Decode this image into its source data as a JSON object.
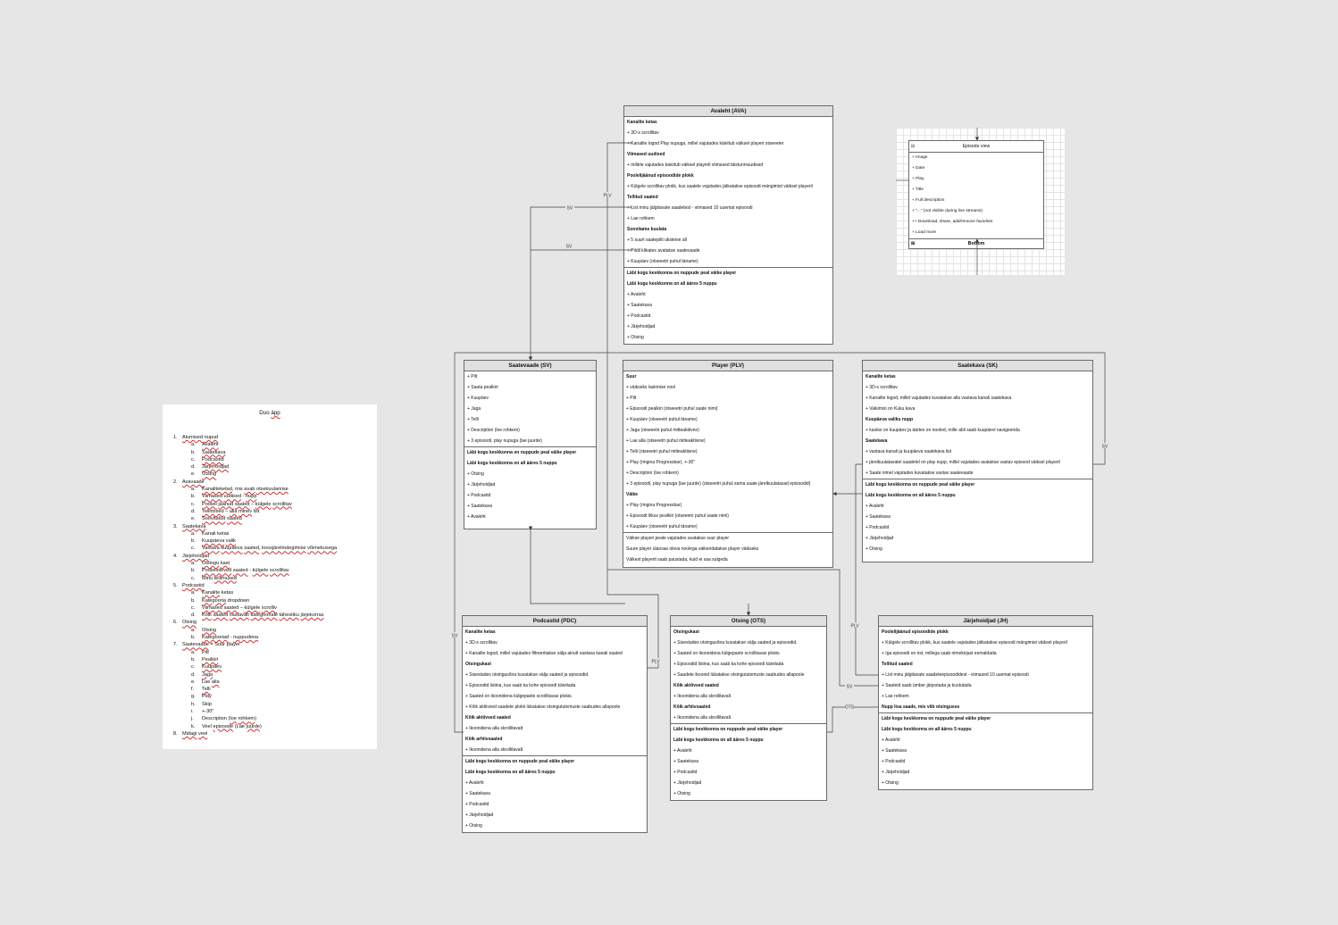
{
  "doc": {
    "title_plain": "Duo ",
    "title_underlined": "äpp",
    "items": [
      {
        "level": 1,
        "n": "1.",
        "html": "<u>Alumised</u> <u>nupud</u>"
      },
      {
        "level": 2,
        "n": "a.",
        "html": "<u>Avaleht</u>"
      },
      {
        "level": 2,
        "n": "b.",
        "html": "<u>Saatekava</u>"
      },
      {
        "level": 2,
        "n": "c.",
        "html": "<u>Podcastid</u>"
      },
      {
        "level": 2,
        "n": "d.",
        "html": "<u>Järjehoidjad</u>"
      },
      {
        "level": 2,
        "n": "e.",
        "html": "<u>Otsing</u>"
      },
      {
        "level": 1,
        "n": "2.",
        "html": "<u>Avavaade</u>"
      },
      {
        "level": 2,
        "n": "a.",
        "html": "<u>Kanaliteketad</u>, mis <u>avab</u> <u>otsekuulamise</u>"
      },
      {
        "level": 2,
        "n": "b.",
        "html": "<u>Viimased</u> <u>uudised</u> - <u>nupp</u>"
      },
      {
        "level": 2,
        "n": "c.",
        "html": "<u>Pooleli</u> <u>jäänud</u> <u>saated</u> – <u>külgele</u> <u>scrollitav</u>"
      },
      {
        "level": 2,
        "n": "d.",
        "html": "<u>Tellimised</u> – <u>alla</u> <u>minev</u> list"
      },
      {
        "level": 2,
        "n": "e.",
        "html": "<u>Soovitatud</u> <u>saated</u>"
      },
      {
        "level": 1,
        "n": "3.",
        "html": "<u>Saatekava</u>"
      },
      {
        "level": 2,
        "n": "a.",
        "html": "Kanali ketas"
      },
      {
        "level": 2,
        "n": "b.",
        "html": "<u>Kuupäeva</u> <u>valik</u>"
      },
      {
        "level": 2,
        "n": "c.",
        "html": "<u>Vastava</u> <u>kuupäeva</u> <u>saated</u>, <u>koosjärelmängimise</u> <u>võimekusega</u>"
      },
      {
        "level": 1,
        "n": "4.",
        "html": "<u>Järjehoidjad</u>"
      },
      {
        "level": 2,
        "n": "a.",
        "html": "<u>Otsingu</u> <u>kast</u>"
      },
      {
        "level": 2,
        "n": "b.",
        "html": "<u>Poolelioleved</u> <u>saated</u>  - <u>külgele</u> <u>scrollitav</u>"
      },
      {
        "level": 2,
        "n": "c.",
        "html": "Minu <u>tellimused</u>"
      },
      {
        "level": 1,
        "n": "5.",
        "html": "<u>Podcastid</u>"
      },
      {
        "level": 2,
        "n": "a.",
        "html": "<u>Kanalite</u> ketas"
      },
      {
        "level": 2,
        "n": "b.",
        "html": "<u>Kategooria</u> dropdown"
      },
      {
        "level": 2,
        "n": "c.",
        "html": "<u>Viimased</u> <u>saated</u> – <u>külgele</u> <u>scrolliv</u>"
      },
      {
        "level": 2,
        "n": "d.",
        "html": "<u>Kõik</u> <u>saated</u> <u>vastavalt</u> <u>kategooriale</u> <u>tähestiku</u> <u>järjekorras</u>"
      },
      {
        "level": 1,
        "n": "6.",
        "html": "<u>Otsing</u>"
      },
      {
        "level": 2,
        "n": "a.",
        "html": "<u>Otsing</u>"
      },
      {
        "level": 2,
        "n": "b.",
        "html": "<u>Kategooriad</u> - <u>nuppudena</u>"
      },
      {
        "level": 1,
        "n": "7.",
        "html": "<u>Saatevaade</u> = Suur player"
      },
      {
        "level": 2,
        "n": "a.",
        "html": "Pilt"
      },
      {
        "level": 2,
        "n": "b.",
        "html": "<u>Pealkiri</u>"
      },
      {
        "level": 2,
        "n": "c.",
        "html": "<u>Kuupäev</u>"
      },
      {
        "level": 2,
        "n": "d.",
        "html": "<u>Jaga</u>"
      },
      {
        "level": 2,
        "n": "e.",
        "html": "Lae <u>alla</u>"
      },
      {
        "level": 2,
        "n": "f.",
        "html": "<u>Telli</u>"
      },
      {
        "level": 2,
        "n": "g.",
        "html": "Play"
      },
      {
        "level": 2,
        "n": "h.",
        "html": "Skip"
      },
      {
        "level": 2,
        "n": "i.",
        "html": "+-30\""
      },
      {
        "level": 2,
        "n": "j.",
        "html": "Description (<u>loe</u> <u>rohkem</u>)"
      },
      {
        "level": 2,
        "n": "k.",
        "html": "Veel <u>episoode</u> (Lae <u>juurde</u>)"
      },
      {
        "level": 1,
        "n": "8.",
        "html": "<u>Midagi</u> <u>veel</u>"
      }
    ]
  },
  "episode_view": {
    "title": "Episode view",
    "rows": [
      "+ Image",
      "+ Date",
      "+ Play",
      "+ Title",
      "+ Full description",
      "+ \"...\" (not visible during live streams)",
      "++ Download, share, add/remove favorites",
      "+ Load more"
    ],
    "bottom": "Bottom"
  },
  "boxes": [
    {
      "id": "ava",
      "title": "Avaleht (AVA)",
      "sections": [
        [
          {
            "t": "Kanalite ketas",
            "b": true
          },
          {
            "t": "+ 3D-s scrollitav"
          },
          {
            "t": "+ Kanalite logod Play nupuga, millel vajutades käivitub väiksel playeri otseeeter"
          },
          {
            "t": "Viimased uudised",
            "b": true
          },
          {
            "t": "+ millele vajutades käivitub väiksel playeril viimased täistunniuudised"
          },
          {
            "t": "Poolelijäänud episoodide plokk",
            "b": true
          },
          {
            "t": "+ Külgele scrollitav plokk, kus saatele vajutades jätkatakse episoodi mängimist väiksel playeril"
          },
          {
            "t": "Tellitud saated",
            "b": true
          },
          {
            "t": "+ List minu jälgitavate saadetest - viimased 10 uuemat episoodi"
          },
          {
            "t": "+ Lae rohkem"
          },
          {
            "t": "Soovitame kuulata",
            "b": true
          },
          {
            "t": "+ 5 suurt saatepilti üksteise all"
          },
          {
            "t": "+ Pildil klikates avatakse saatevaade"
          },
          {
            "t": "+ Kuupäev (otseeetri puhul täname)"
          }
        ],
        [
          {
            "t": "Läbi kogu keskkonna on nuppude peal väike player",
            "b": true
          },
          {
            "t": "Läbi kogu keskkonna on all ääres 5 nuppu",
            "b": true
          },
          {
            "t": "+ Avaleht"
          },
          {
            "t": "+ Saatekava"
          },
          {
            "t": "+ Podcastid"
          },
          {
            "t": "+ Järjehoidjad"
          },
          {
            "t": "+ Otsing"
          }
        ]
      ]
    },
    {
      "id": "sv",
      "title": "Saatevaade (SV)",
      "sections": [
        [
          {
            "t": "+ Pilt"
          },
          {
            "t": "+ Saata pealkiri"
          },
          {
            "t": "+ Kuupäev"
          },
          {
            "t": "+ Jaga"
          },
          {
            "t": "+ Telli"
          },
          {
            "t": "+ Description (loe rohkem)"
          },
          {
            "t": "+ 3 episoodi, play nupuga (lae juurde)"
          }
        ],
        [
          {
            "t": "Läbi kogu keskkonna on nuppude peal väike player",
            "b": true
          },
          {
            "t": "Läbi kogu keskkonna on all ääres 5 nuppu",
            "b": true
          },
          {
            "t": "+ Otsing"
          },
          {
            "t": "+ Järjehoidjad"
          },
          {
            "t": "+ Podcastid"
          },
          {
            "t": "+ Saatekava"
          },
          {
            "t": "+ Avaleht"
          }
        ]
      ]
    },
    {
      "id": "plv",
      "title": "Player (PLV)",
      "sections": [
        [
          {
            "t": "Suur",
            "b": true
          },
          {
            "t": "+ väikseks laskmise nool"
          },
          {
            "t": "+ Pilt"
          },
          {
            "t": "+ Episoodi pealkiri (otseeetri puhul saate nimi)"
          },
          {
            "t": "+ Kuupäev (otseeetri puhul täname)"
          },
          {
            "t": "+ Jaga (otseeetri puhul mitteaktiivne)"
          },
          {
            "t": "+ Lae alla (otseeetri puhul mitteaktiivne)"
          },
          {
            "t": "+ Telli (otseeetri puhul mitteaktiivne)"
          },
          {
            "t": "+ Play (ringina Progressbar), +-30\""
          },
          {
            "t": "+ Description (loe rohkem)"
          },
          {
            "t": "+ 3 episoodi, play nupuga (lae juurde) (otseeetri puhul sama saate järelkuulatavad episoodid)"
          },
          {
            "t": "Väike",
            "b": true
          },
          {
            "t": "+ Play (ringina Progressbar)"
          },
          {
            "t": "+ Episoodi liikuv pealkiri (otseeetri puhul saate nimi)"
          },
          {
            "t": "+ Kuupäev (otseeetri puhul täname)"
          }
        ],
        [
          {
            "t": "Väikse playeri peale vajutades avatakse suur player"
          },
          {
            "t": "Suure player ülaosas oleva noolega väikendatakse player väikseks"
          },
          {
            "t": "Väikest playerit saab paustada, kuid ei saa sulgeda"
          }
        ]
      ]
    },
    {
      "id": "sk",
      "title": "Saatekava (SK)",
      "sections": [
        [
          {
            "t": "Kanalite ketas",
            "b": true
          },
          {
            "t": "+ 3D-s scrollitav"
          },
          {
            "t": "+ Kanalite logod, millel vajutades kuvatakse alla vastava kanali saatekava"
          },
          {
            "t": "+ Vaikimisi on Kuku kava"
          },
          {
            "t": "Kuupäeva valiku nupp",
            "b": true
          },
          {
            "t": "+ kaoksi on kuupäev ja äärtes on nooled, mille abil saab kuupäevi navigeerida"
          },
          {
            "t": "Saatekava",
            "b": true
          },
          {
            "t": "+ vastava kanali ja kuupäeva saatekava list"
          },
          {
            "t": "+ järelkuulatavatel saadetel on play nupp, millel vajutades avatakse vastav episood väiksel playeril"
          },
          {
            "t": "+ Saate nimel vajutades kuvatakse vastav saatevaade"
          }
        ],
        [
          {
            "t": "Läbi kogu keskkonna on nuppude peal väike player",
            "b": true
          },
          {
            "t": "Läbi kogu keskkonna on all ääres 5 nuppu",
            "b": true
          },
          {
            "t": "+ Avaleht"
          },
          {
            "t": "+ Saatekava"
          },
          {
            "t": "+ Podcastid"
          },
          {
            "t": "+ Järjehoidjad"
          },
          {
            "t": "+ Otsing"
          }
        ]
      ]
    },
    {
      "id": "pdc",
      "title": "Podcastid (PDC)",
      "sections": [
        [
          {
            "t": "Kanalite ketas",
            "b": true
          },
          {
            "t": "+ 3D-s scrollitav"
          },
          {
            "t": "+ Kanalite logod, millel vajutades filtreeritakse välja ainult vastava kanali saated"
          },
          {
            "t": "Otsingukast",
            "b": true
          },
          {
            "t": "+ Sisestades otsingusõna kuvatakse välja saated ja episoodid."
          },
          {
            "t": "+ Episoodid listina, kus saab ka kohe episoodi käivitada"
          },
          {
            "t": "+ Saated on ikoonidena külgepaele  scrollitavas plokis."
          },
          {
            "t": "+ Kõik aktiivsed saadete plokk  lükatakse otsingutulemuste saabudes allapoole"
          },
          {
            "t": "Kõik aktiivsed saated",
            "b": true
          },
          {
            "t": "+ Ikoonidena alla skrollitavalt"
          },
          {
            "t": "Kõik arhiivsaated",
            "b": true
          },
          {
            "t": "+ Ikoonidena alla skrollitavalt"
          }
        ],
        [
          {
            "t": "Läbi kogu keskkonna on nuppude peal väike player",
            "b": true
          },
          {
            "t": "Läbi kogu keskkonna on all ääres 5 nuppu",
            "b": true
          },
          {
            "t": "+ Avaleht"
          },
          {
            "t": "+ Saatekava"
          },
          {
            "t": "+ Podcastid"
          },
          {
            "t": "+ Järjehoidjad"
          },
          {
            "t": "+ Otsing"
          }
        ]
      ]
    },
    {
      "id": "ots",
      "title": "Otsing (OTS)",
      "sections": [
        [
          {
            "t": "Otsingukast",
            "b": true
          },
          {
            "t": "+ Sisestades otsingusõna kuvatakse välja saated ja episoodid."
          },
          {
            "t": "+ Saated on ikoonidena külgepaele  scrollitavas plokis."
          },
          {
            "t": "+ Episoodid listina, kus saab ka kohe episoodi käivitada"
          },
          {
            "t": "+ Saadete ikoonid lükatakse otsingutulemuste saabudes allapoole"
          },
          {
            "t": "Kõik aktiivsed saated",
            "b": true
          },
          {
            "t": "+ Ikoonidena alla skrollitavalt"
          },
          {
            "t": "Kõik arhiivsaated",
            "b": true
          },
          {
            "t": "+ Ikoonidena alla skrollitavalt"
          }
        ],
        [
          {
            "t": "Läbi kogu keskkonna on nuppude peal väike player",
            "b": true
          },
          {
            "t": "Läbi kogu keskkonna on all ääres 5 nuppu",
            "b": true
          },
          {
            "t": "+ Avaleht"
          },
          {
            "t": "+ Saatekava"
          },
          {
            "t": "+ Podcastid"
          },
          {
            "t": "+ Järjehoidjad"
          },
          {
            "t": "+ Otsing"
          }
        ]
      ]
    },
    {
      "id": "jh",
      "title": "Järjehoidjad (JH)",
      "sections": [
        [
          {
            "t": "Poolelijäänud episoodide plokk",
            "b": true
          },
          {
            "t": "+ Külgele scrollitav plokk, kus saatele vajutades jätkatakse episoodi mängimist väiksel playeril"
          },
          {
            "t": "+ Iga episoodi on rist, millega saab nimekirjast eemaldada"
          },
          {
            "t": "Tellitud saated",
            "b": true
          },
          {
            "t": "+ List minu jälgitavate saadeteepisoodidest - viimased 10 uuemat episoodi"
          },
          {
            "t": "+ Saateid saab ümber järjestada ja kustutada"
          },
          {
            "t": "+ Lae rohkem"
          },
          {
            "t": "Nupp lisa saade, mis viib otsingusse",
            "b": true
          }
        ],
        [
          {
            "t": "Läbi kogu keskkonna on nuppude peal väike player",
            "b": true
          },
          {
            "t": "Läbi kogu keskkonna on all ääres 5 nuppu",
            "b": true
          },
          {
            "t": "+ Avaleht"
          },
          {
            "t": "+ Saatekava"
          },
          {
            "t": "+ Podcastid"
          },
          {
            "t": "+ Järjehoidjad"
          },
          {
            "t": "+ Otsing"
          }
        ]
      ]
    }
  ],
  "edge_labels": [
    "PLV",
    "SV",
    "SV",
    "SV",
    "SV",
    "PLV",
    "PLV",
    "SV",
    "OTS"
  ]
}
